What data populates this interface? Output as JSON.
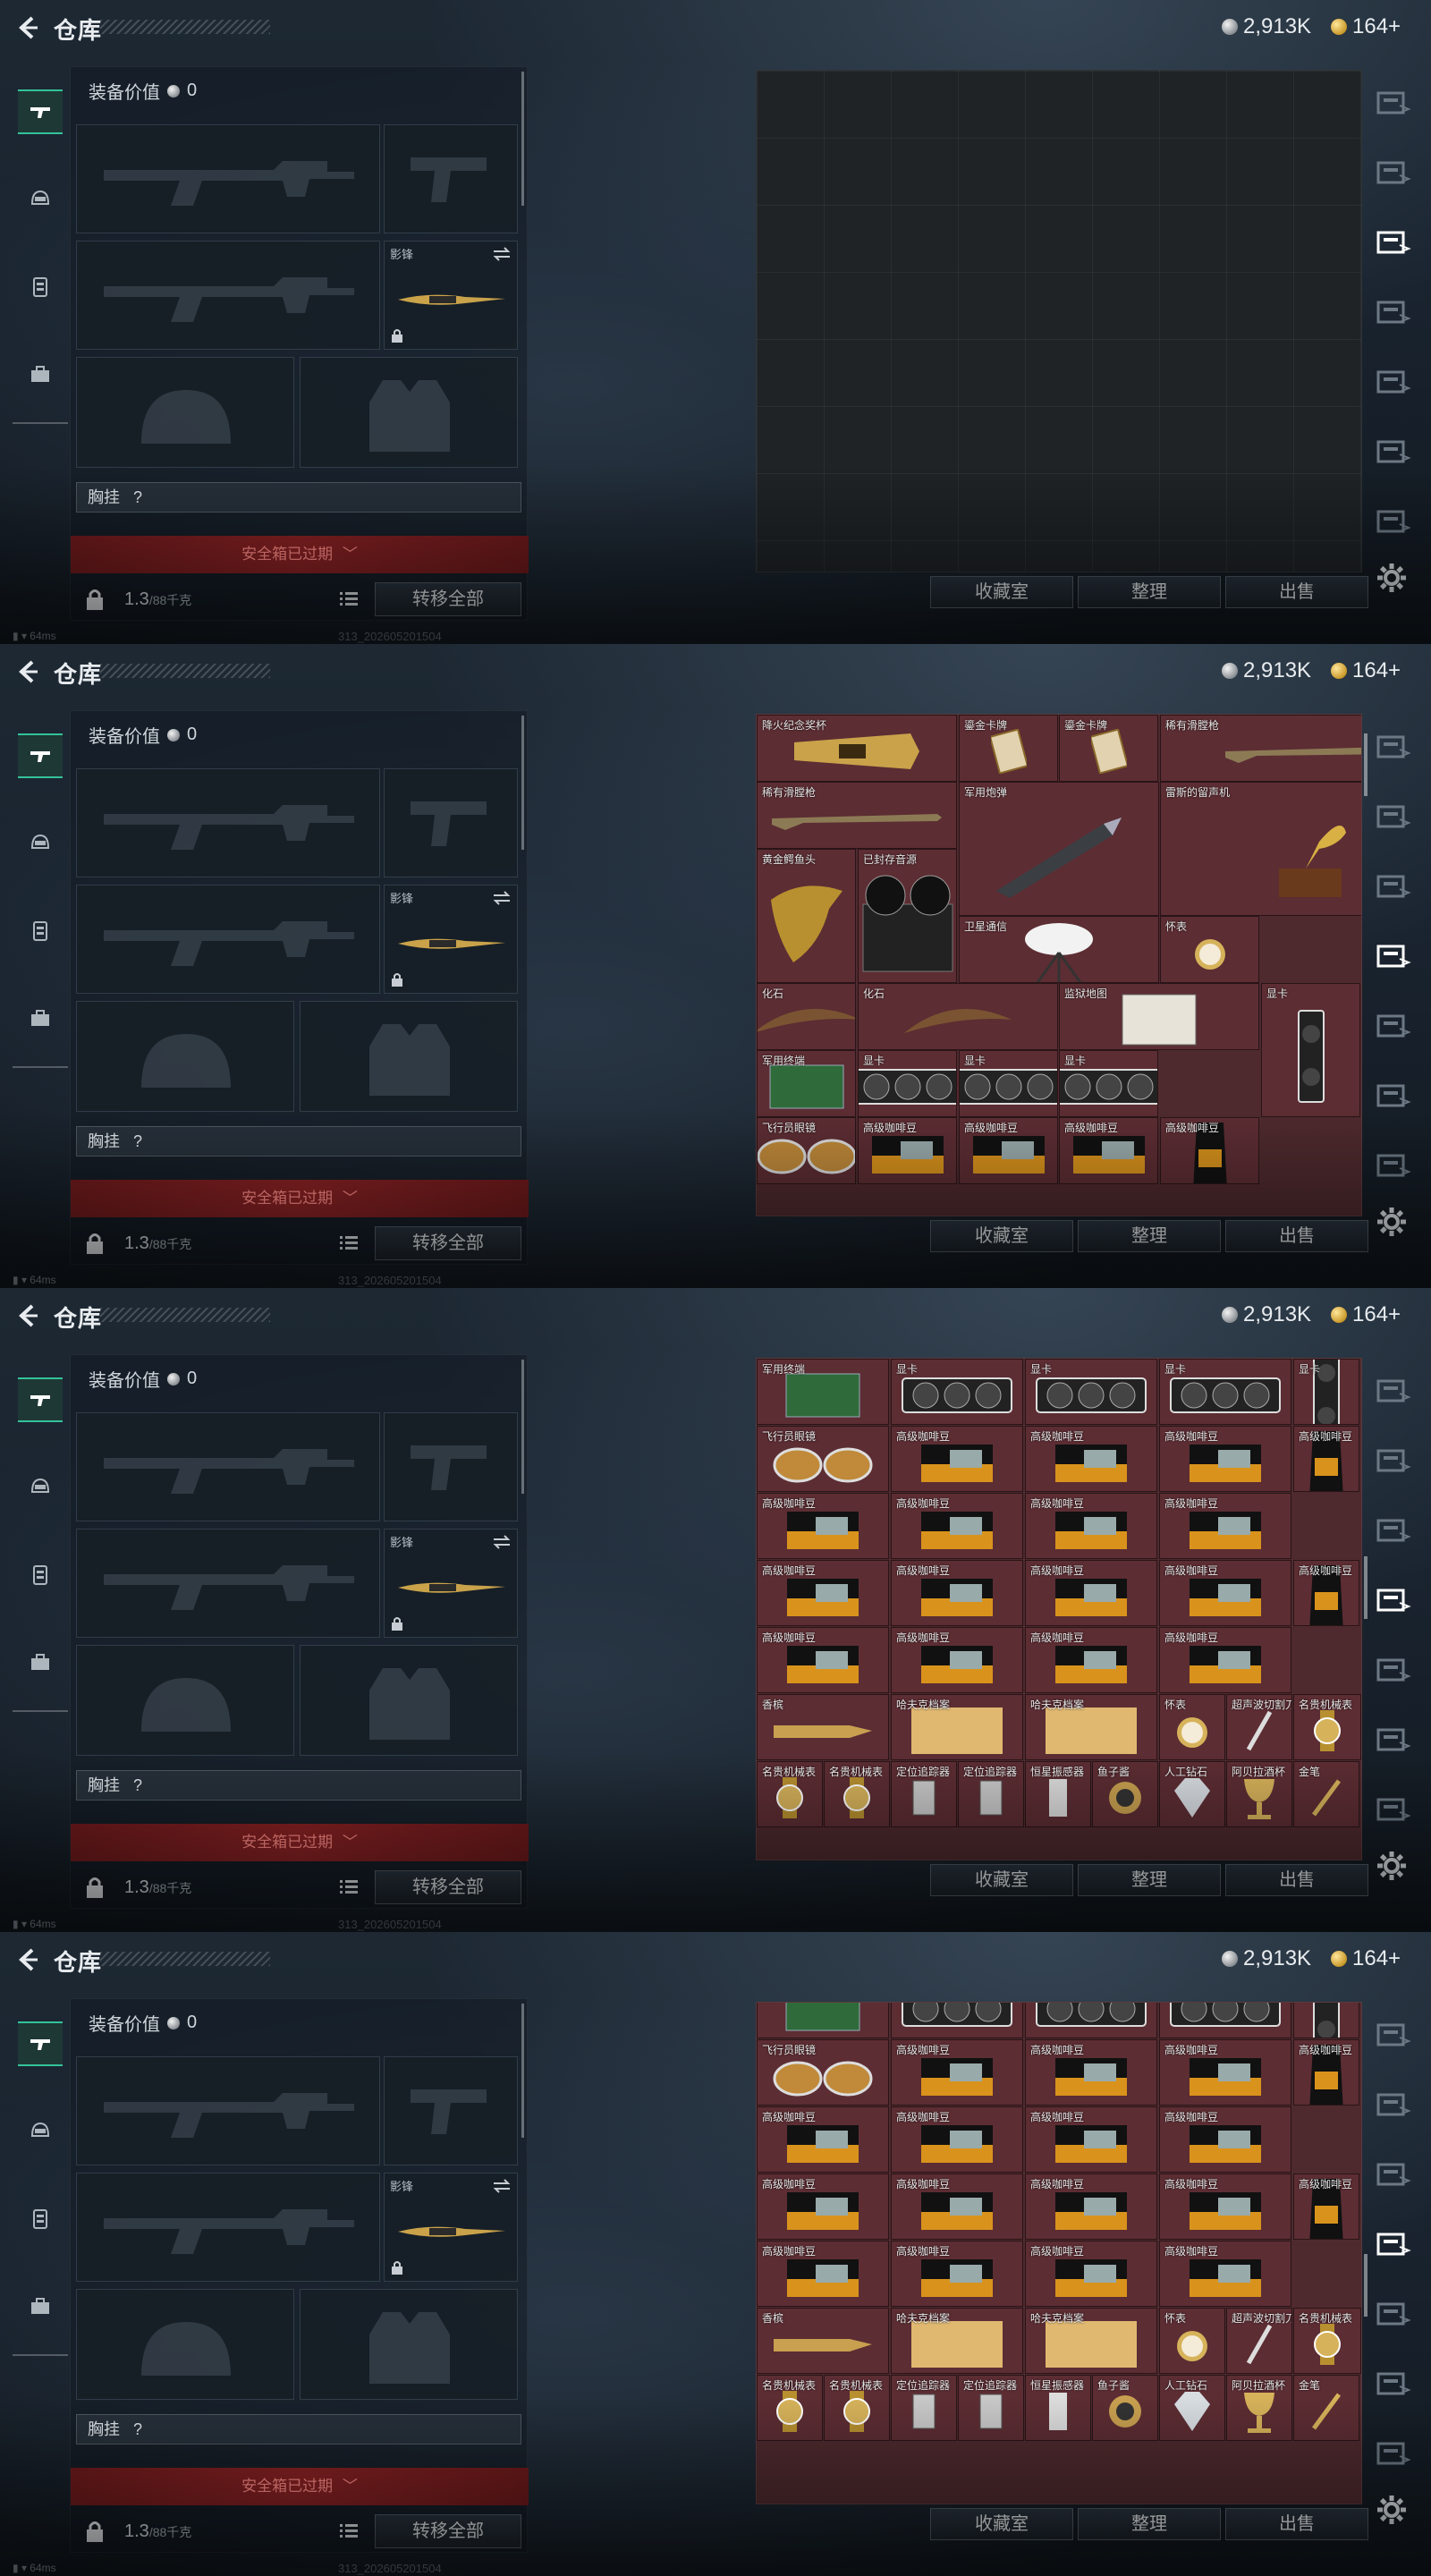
{
  "header": {
    "title": "仓库",
    "currency_silver": "2,913K",
    "currency_gold": "164+"
  },
  "equipment": {
    "value_label": "装备价值",
    "value": "0",
    "shadow_slot_label": "影锋",
    "chest_rig_label": "胸挂",
    "chest_rig_value": "?",
    "safebox_label": "安全箱已过期",
    "weight": "1.3",
    "weight_max": "/88千克",
    "transfer_label": "转移全部"
  },
  "storage": {
    "collection_label": "收藏室",
    "sort_label": "整理",
    "sell_label": "出售"
  },
  "status": {
    "ping": "64ms",
    "build": "313_2026052015​04"
  },
  "items": {
    "trophy": "降火纪念奖杯",
    "gold_card": "鎏金卡牌",
    "rare_musket": "稀有滑膛枪",
    "missile": "军用炮弹",
    "phonograph": "雷斯的留声机",
    "croc_head": "黄金鳄鱼头",
    "recorder": "已封存音源",
    "satellite": "卫星通信",
    "pocket_watch": "怀表",
    "fossil": "化石",
    "intel_map": "监狱地图",
    "gpu": "显卡",
    "military_board": "军用终端",
    "pilot_glasses": "飞行员眼镜",
    "coffee": "高级咖啡豆",
    "cigar": "香槟",
    "hafu_file": "哈夫克档案",
    "scalpel": "超声波切割刀",
    "luxury_watch": "名贵机械表",
    "locator": "定位追踪器",
    "sensor": "恒星振感器",
    "fish_lens": "鱼子酱",
    "diamond": "人工钻石",
    "goblet": "阿贝拉酒杯",
    "gold_pen": "金笔"
  },
  "colors": {
    "accent": "#33c29a",
    "item_bg": "#5c2d33",
    "safebox_bg": "#8b2224"
  },
  "icons": [
    "back-icon",
    "gun-icon",
    "helmet-icon",
    "armor-icon",
    "case-icon",
    "lock-icon",
    "list-icon",
    "gear-icon",
    "swap-icon",
    "storage-icon"
  ]
}
